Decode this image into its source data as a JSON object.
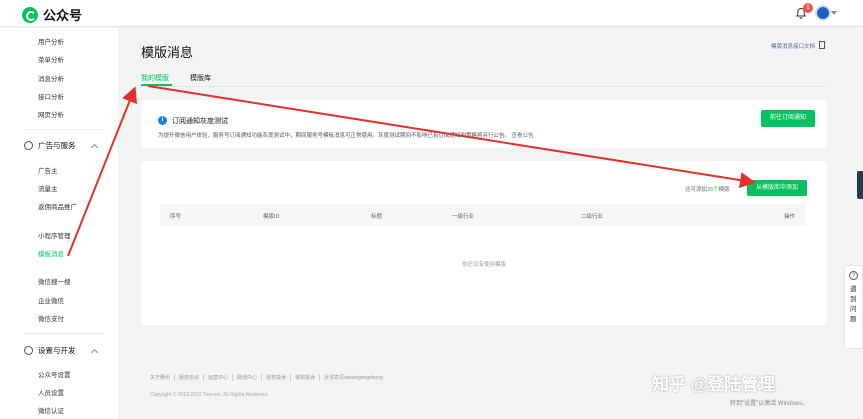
{
  "app": {
    "logo_text": "公众号",
    "notification_count": "1"
  },
  "sidebar": {
    "top_items": [
      {
        "label": "用户分析"
      },
      {
        "label": "菜单分析"
      },
      {
        "label": "消息分析"
      },
      {
        "label": "接口分析"
      },
      {
        "label": "网页分析"
      }
    ],
    "group_ads": {
      "label": "广告与服务"
    },
    "ads_items": [
      {
        "label": "广告主"
      },
      {
        "label": "流量主"
      },
      {
        "label": "返佣商品推广"
      }
    ],
    "service_items": [
      {
        "label": "小程序管理"
      },
      {
        "label": "模板消息"
      }
    ],
    "more_items": [
      {
        "label": "微信搜一搜"
      },
      {
        "label": "企业微信"
      },
      {
        "label": "微信支付"
      }
    ],
    "group_settings": {
      "label": "设置与开发"
    },
    "settings_items": [
      {
        "label": "公众号设置"
      },
      {
        "label": "人员设置"
      },
      {
        "label": "微信认证"
      }
    ]
  },
  "main": {
    "title": "模版消息",
    "doc_link": "模版消息接口文档",
    "tabs": [
      {
        "label": "我的模版"
      },
      {
        "label": "模版库"
      }
    ],
    "notice": {
      "title": "订阅通知灰度测试",
      "desc": "为提升微信用户体验，服务号订阅通知功能灰度测试中，期间服务号模板消息可正常使用。灰度测试期间不影响已有订阅通知的策略将另行公告。",
      "link": "查看公告",
      "button": "前往订阅通知"
    },
    "table": {
      "quota_prefix": "还可添加",
      "quota_num": "25个",
      "quota_suffix": "模版",
      "add_button": "从模版库中添加",
      "columns": [
        "序号",
        "模版ID",
        "标题",
        "一级行业",
        "二级行业",
        "操作"
      ],
      "empty": "你还没有使用模版"
    }
  },
  "footer": {
    "links": [
      "关于腾讯",
      "服务协议",
      "运营中心",
      "辟谣中心",
      "侵权投诉",
      "侵权投诉",
      "反馈意见weixingongzhong"
    ],
    "copyright": "Copyright © 2012-2022 Tencent. All Rights Reserved."
  },
  "watermark": "知乎 @登陆管理",
  "windows_text": "转到\"设置\"以激活 Windows。",
  "help": {
    "label": "遇到问题"
  },
  "colors": {
    "accent": "#07c160",
    "arrow": "#e0322b",
    "link": "#576b95"
  }
}
